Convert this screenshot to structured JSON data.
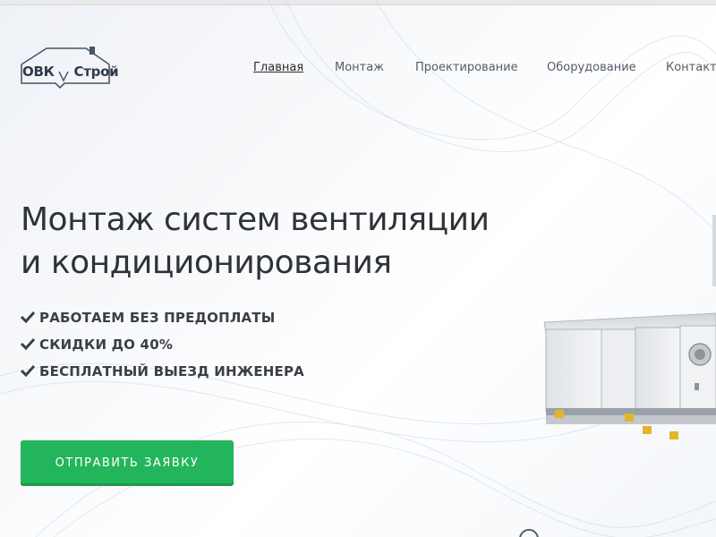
{
  "logo": {
    "part1": "ОВК",
    "part2": "Строй"
  },
  "nav": {
    "items": [
      {
        "label": "Главная",
        "active": true
      },
      {
        "label": "Монтаж",
        "active": false
      },
      {
        "label": "Проектирование",
        "active": false
      },
      {
        "label": "Оборудование",
        "active": false
      },
      {
        "label": "Контакты",
        "active": false
      }
    ]
  },
  "hero": {
    "title_line1": "Монтаж систем вентиляции",
    "title_line2": "и кондиционирования",
    "features": [
      "РАБОТАЕМ БЕЗ ПРЕДОПЛАТЫ",
      "СКИДКИ ДО 40%",
      "БЕСПЛАТНЫЙ ВЫЕЗД ИНЖЕНЕРА"
    ],
    "cta_label": "ОТПРАВИТЬ ЗАЯВКУ"
  },
  "icons": {
    "feature_bullet": "check-icon",
    "equipment": "air-handling-unit-image",
    "scroll": "scroll-down-icon"
  },
  "colors": {
    "accent": "#23b55b",
    "text_dark": "#2f3338",
    "nav_text": "#555c66"
  }
}
